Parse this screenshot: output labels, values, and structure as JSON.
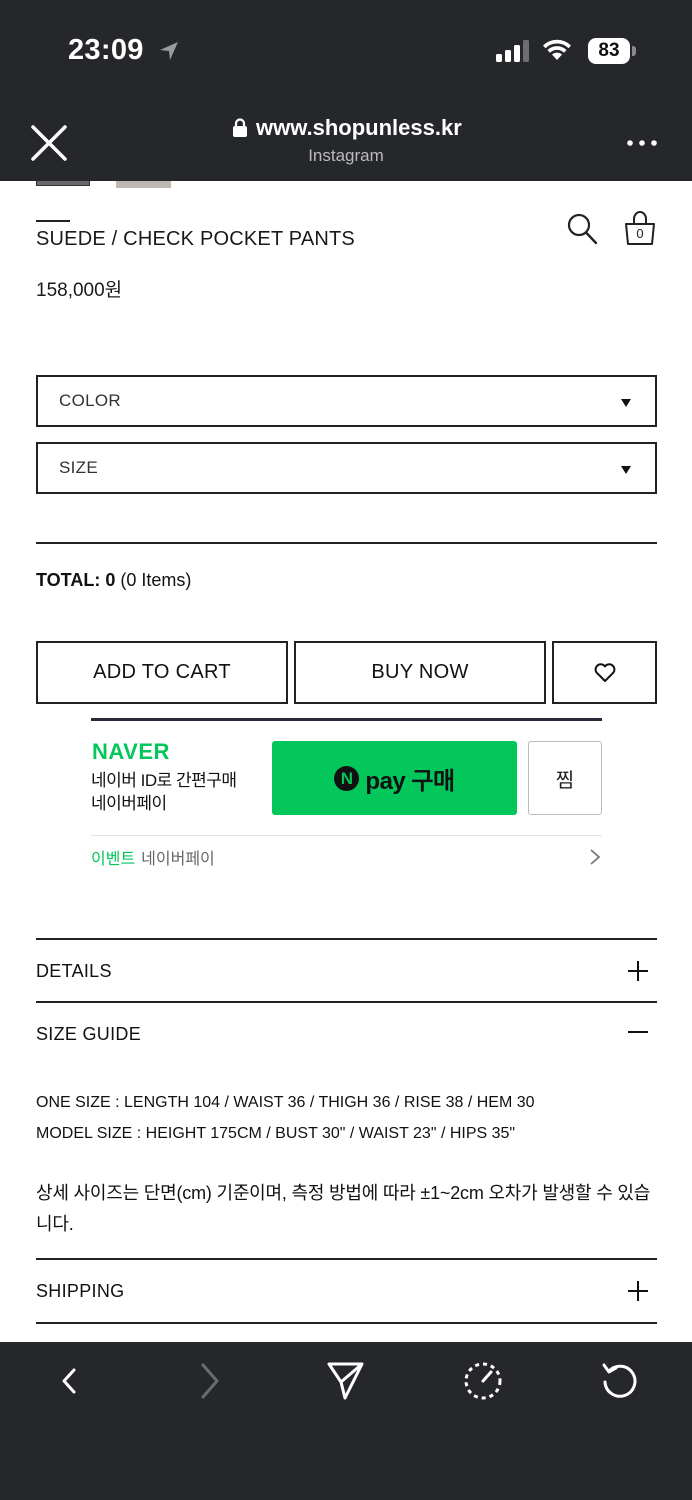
{
  "status_bar": {
    "time": "23:09",
    "battery": "83"
  },
  "browser": {
    "url": "www.shopunless.kr",
    "source": "Instagram"
  },
  "product": {
    "title": "SUEDE / CHECK POCKET PANTS",
    "price": "158,000원",
    "cart_count": "0"
  },
  "options": [
    {
      "label": "COLOR"
    },
    {
      "label": "SIZE"
    }
  ],
  "total": {
    "label": "TOTAL:",
    "value": "0",
    "items": "(0 Items)"
  },
  "actions": {
    "add_to_cart": "ADD TO CART",
    "buy_now": "BUY NOW"
  },
  "naver_pay": {
    "logo": "NAVER",
    "desc_line1": "네이버 ID로 간편구매",
    "desc_line2": "네이버페이",
    "pay_label": "pay 구매",
    "n_mark": "N",
    "wish_label": "찜",
    "event_tag": "이벤트",
    "event_text": "네이버페이",
    "brand_color": "#03c75a"
  },
  "accordions": [
    {
      "title": "DETAILS",
      "state": "collapsed"
    },
    {
      "title": "SIZE GUIDE",
      "state": "expanded"
    },
    {
      "title": "SHIPPING",
      "state": "collapsed"
    }
  ],
  "size_guide": {
    "line1": "ONE SIZE : LENGTH 104 / WAIST 36 / THIGH 36 / RISE 38 / HEM 30",
    "line2": "MODEL SIZE : HEIGHT 175CM / BUST 30\" / WAIST 23\" / HIPS 35\"",
    "note": "상세 사이즈는 단면(cm) 기준이며, 측정 방법에 따라 ±1~2cm 오차가 발생할 수 있습니다."
  },
  "toolbar_icons": [
    "back-icon",
    "forward-icon",
    "share-icon",
    "speed-icon",
    "reload-icon"
  ],
  "theme": {
    "chrome_bg": "#26272b",
    "border": "#222222"
  }
}
